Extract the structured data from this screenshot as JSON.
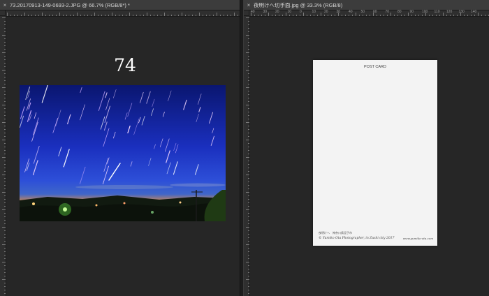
{
  "left_document": {
    "tab_close": "×",
    "tab_title": "73.20170913-149-0693-2.JPG @ 66.7% (RGB/8*) *",
    "page_number": "74"
  },
  "right_document": {
    "tab_close": "×",
    "tab_title": "夜明けへ切手面.jpg @ 33.3% (RGB/8)",
    "ruler_labels": [
      "40",
      "30",
      "20",
      "10",
      "0",
      "10",
      "20",
      "30",
      "40",
      "50",
      "60",
      "70",
      "80",
      "90",
      "100",
      "110",
      "120",
      "130",
      "140"
    ],
    "postcard": {
      "title": "POST CARD",
      "caption": "夜明けへ　神奈川県逗子市",
      "credit": "© Yumiko Ota Photographer, in Zushi city 2017",
      "url": "www.yumiko-ota.com"
    }
  },
  "colors": {
    "ui_dark": "#282828",
    "tab_bg": "#3c3c3c",
    "sky_top": "#0a1a7a",
    "sky_mid": "#1d33c8",
    "horizon_glow": "#f08a3a"
  }
}
